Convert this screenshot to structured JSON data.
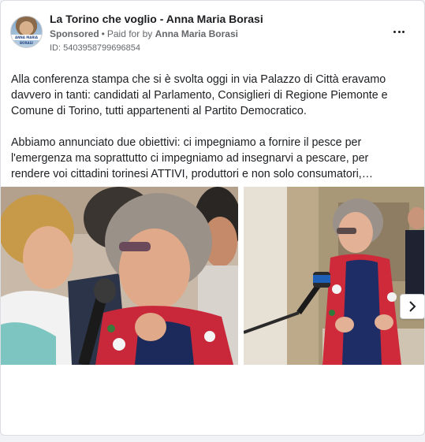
{
  "ad": {
    "page_name": "La Torino che voglio - Anna Maria Borasi",
    "sponsored_label": "Sponsored",
    "separator": "•",
    "paid_for_prefix": "Paid for by",
    "payer": "Anna Maria Borasi",
    "ad_id": "ID: 5403958799696854",
    "avatar_caption": "ANNA MARIA BORASI"
  },
  "body": {
    "paragraph_1": "Alla conferenza stampa che si è svolta oggi in via Palazzo di Città eravamo davvero in tanti: candidati al Parlamento, Consiglieri di Regione Piemonte e Comune di Torino, tutti appartenenti al Partito Democratico.",
    "paragraph_2": "Abbiamo annunciato due obiettivi: ci impegniamo a fornire il pesce per l'emergenza ma soprattutto ci impegniamo ad insegnarvi a pescare, per rendere voi cittadini torinesi ATTIVI, produttori e non solo consumatori, consapevoli. La Torino che voglio è una città che si muove insieme."
  },
  "colors": {
    "text_primary": "#1c1e21",
    "text_secondary": "#65676b",
    "card_border": "#dadde1",
    "background": "#f0f2f5"
  },
  "icons": {
    "more": "more-options-icon",
    "next": "chevron-right-icon"
  }
}
